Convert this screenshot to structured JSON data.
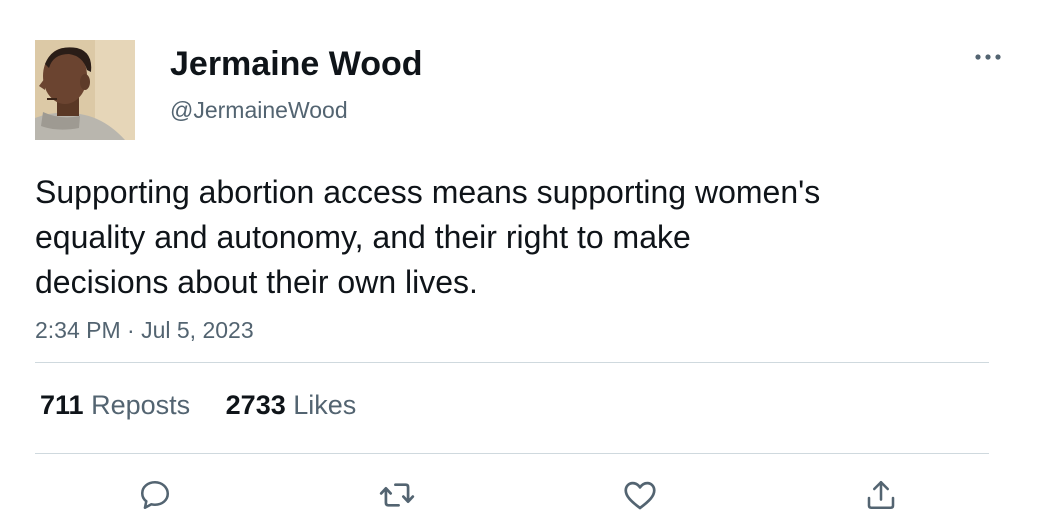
{
  "author": {
    "display_name": "Jermaine Wood",
    "handle": "@JermaineWood",
    "avatar_icon": "profile-photo"
  },
  "tweet": {
    "lines": [
      "Supporting abortion access means supporting women's",
      "equality and autonomy, and their right to make",
      "decisions about their own lives."
    ],
    "timestamp": "2:34 PM · Jul 5, 2023"
  },
  "stats": {
    "reposts_count": "711",
    "reposts_label": "Reposts",
    "likes_count": "2733",
    "likes_label": "Likes"
  },
  "actions": {
    "reply_icon": "speech-bubble-icon",
    "repost_icon": "repost-arrows-icon",
    "like_icon": "heart-icon",
    "share_icon": "share-upload-icon"
  },
  "colors": {
    "text_primary": "#0f1419",
    "text_secondary": "#536471",
    "divider": "#cfd9de"
  }
}
